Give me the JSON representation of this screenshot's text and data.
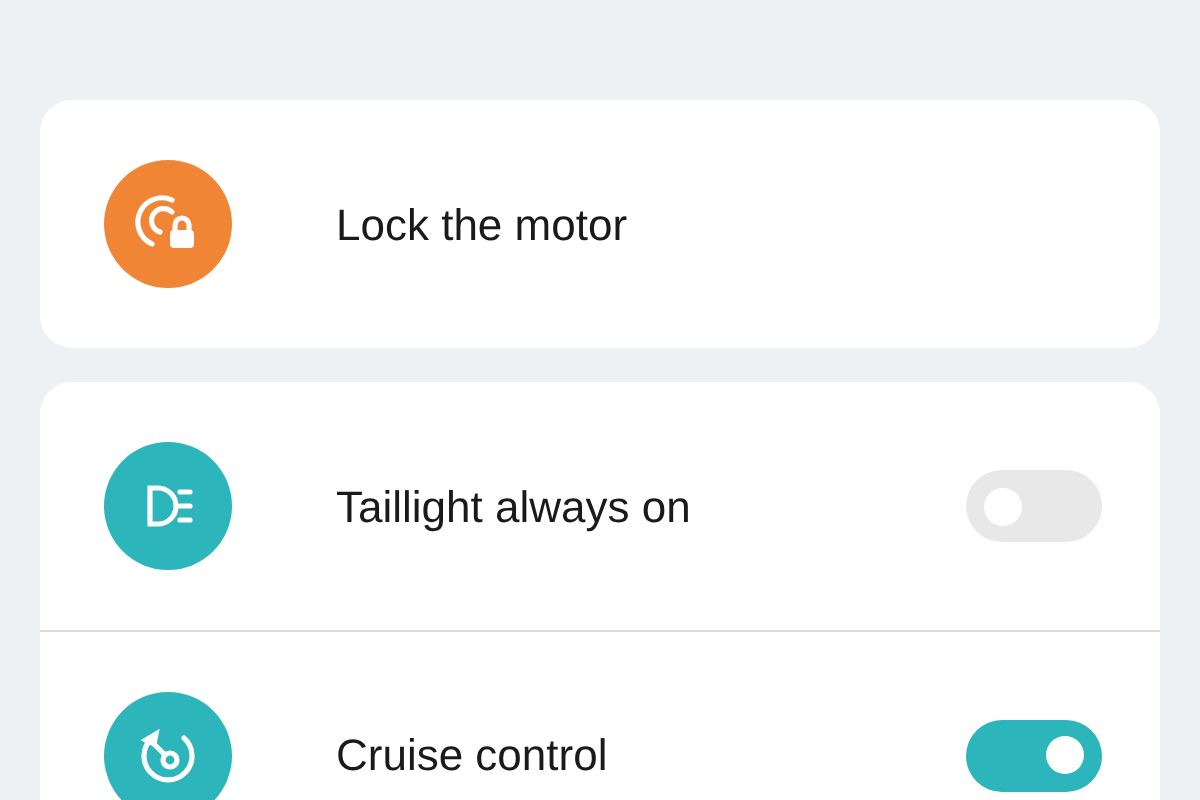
{
  "cards": [
    {
      "rows": [
        {
          "kind": "action",
          "label": "Lock the motor",
          "color": "#f08536"
        }
      ]
    },
    {
      "rows": [
        {
          "kind": "toggle",
          "label": "Taillight always on",
          "color": "#2cb5ba",
          "on": false
        },
        {
          "kind": "toggle",
          "label": "Cruise control",
          "color": "#2cb5ba",
          "on": true
        }
      ]
    }
  ]
}
